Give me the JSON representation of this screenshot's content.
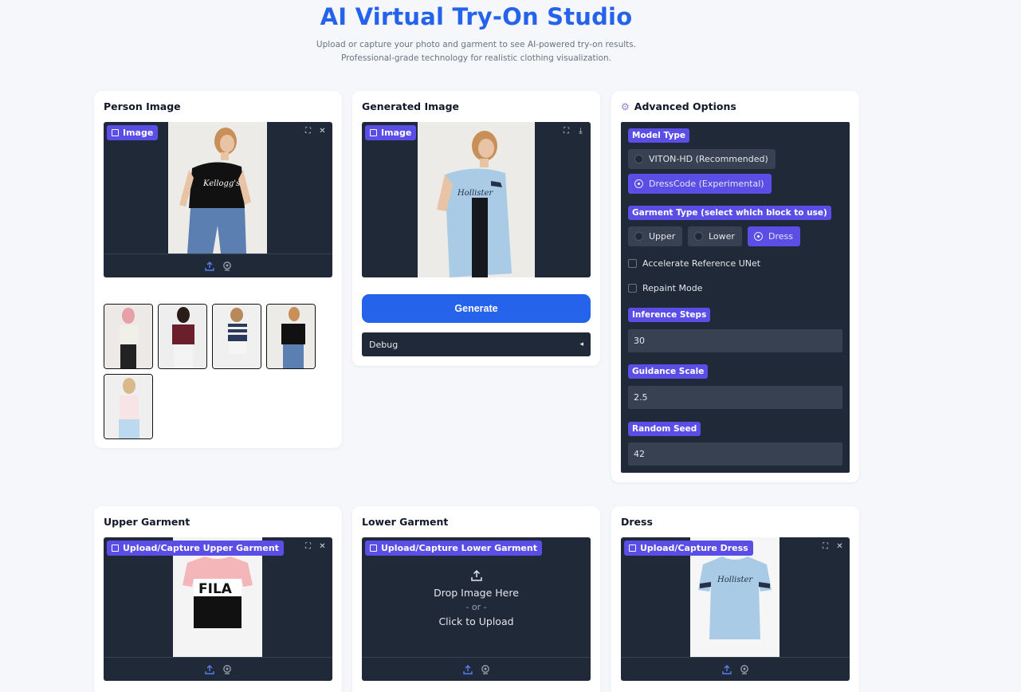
{
  "header": {
    "title": "AI Virtual Try-On Studio",
    "subtitle_line1": "Upload or capture your photo and garment to see AI-powered try-on results.",
    "subtitle_line2": "Professional-grade technology for realistic clothing visualization."
  },
  "person": {
    "title": "Person Image",
    "badge": "Image"
  },
  "generated": {
    "title": "Generated Image",
    "badge": "Image",
    "button": "Generate",
    "debug": "Debug",
    "debug_caret": "◂"
  },
  "advanced": {
    "title": "Advanced Options",
    "model_type_label": "Model Type",
    "model_options": [
      "VITON-HD (Recommended)",
      "DressCode (Experimental)"
    ],
    "model_selected": "DressCode (Experimental)",
    "garment_type_label": "Garment Type (select which block to use)",
    "garment_options": [
      "Upper",
      "Lower",
      "Dress"
    ],
    "garment_selected": "Dress",
    "accelerate_label": "Accelerate Reference UNet",
    "accelerate_checked": false,
    "repaint_label": "Repaint Mode",
    "repaint_checked": false,
    "steps_label": "Inference Steps",
    "steps_value": "30",
    "guidance_label": "Guidance Scale",
    "guidance_value": "2.5",
    "seed_label": "Random Seed",
    "seed_value": "42"
  },
  "upper": {
    "title": "Upper Garment",
    "badge": "Upload/Capture Upper Garment"
  },
  "lower": {
    "title": "Lower Garment",
    "badge": "Upload/Capture Lower Garment",
    "drop_text": "Drop Image Here",
    "or_text": "- or -",
    "click_text": "Click to Upload"
  },
  "dress": {
    "title": "Dress",
    "badge": "Upload/Capture Dress"
  },
  "colors": {
    "accent": "#2563eb",
    "badge": "#5b4ee6",
    "panel_dark": "#1f2937"
  }
}
